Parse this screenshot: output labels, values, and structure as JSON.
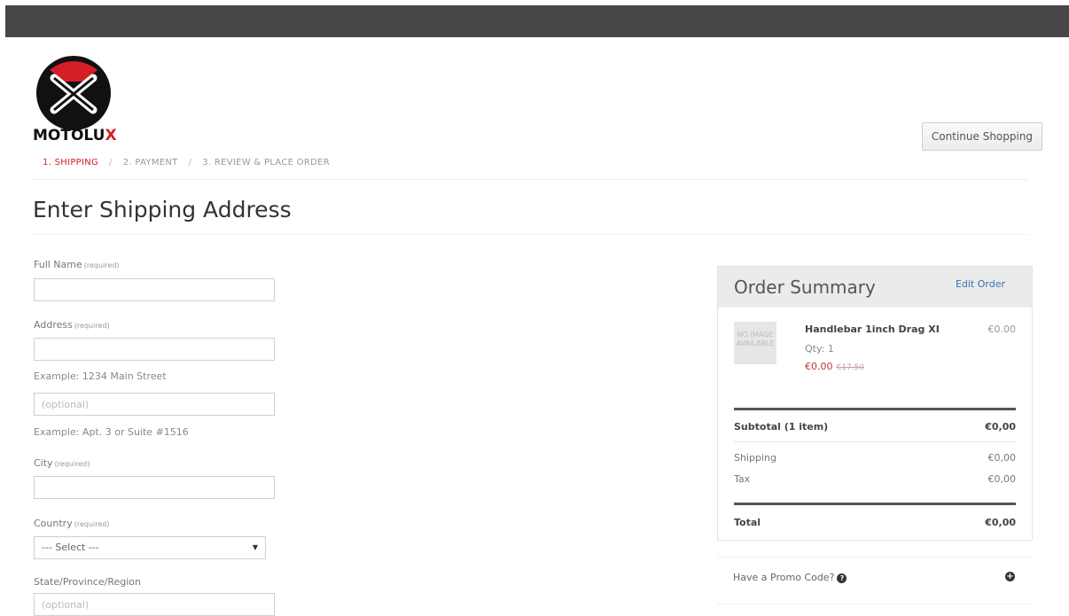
{
  "header": {
    "brand": "MOTOLU",
    "brand_x": "X",
    "continue_label": "Continue Shopping"
  },
  "steps": [
    {
      "label": "1. SHIPPING",
      "active": true
    },
    {
      "label": "2. PAYMENT",
      "active": false
    },
    {
      "label": "3. REVIEW & PLACE ORDER",
      "active": false
    }
  ],
  "step_sep": "/",
  "page_title": "Enter Shipping Address",
  "form": {
    "full_name_label": "Full Name",
    "required": "(required)",
    "address_label": "Address",
    "address_example": "Example: 1234 Main Street",
    "address2_placeholder": "(optional)",
    "address2_example": "Example: Apt. 3 or Suite #1516",
    "city_label": "City",
    "country_label": "Country",
    "country_value": "--- Select ---",
    "state_label": "State/Province/Region",
    "state_placeholder": "(optional)"
  },
  "summary": {
    "title": "Order Summary",
    "edit_label": "Edit Order",
    "thumb_text": "NO IMAGE AVAILABLE",
    "item_name": "Handlebar 1inch Drag XI",
    "item_price": "€0.00",
    "item_qty": "Qty: 1",
    "item_sale_price": "€0.00",
    "item_old_price": "€17.50",
    "subtotal_label": "Subtotal (1 item)",
    "subtotal_value": "€0,00",
    "shipping_label": "Shipping",
    "shipping_value": "€0,00",
    "tax_label": "Tax",
    "tax_value": "€0,00",
    "total_label": "Total",
    "total_value": "€0,00"
  },
  "promo": {
    "label": "Have a Promo Code?",
    "help_glyph": "?",
    "plus_glyph": "+"
  },
  "colors": {
    "accent": "#d21f26",
    "link": "#3a6fb5",
    "topbar": "#474747"
  }
}
